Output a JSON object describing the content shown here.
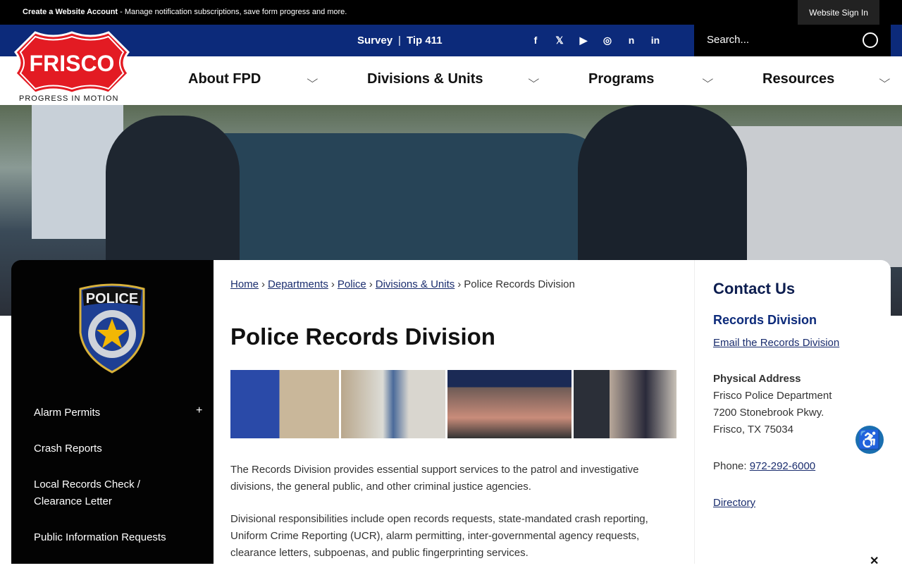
{
  "topbar": {
    "create_label": "Create a Website Account",
    "create_desc": " - Manage notification subscriptions, save form progress and more.",
    "signin": "Website Sign In"
  },
  "utility": {
    "links": [
      "Survey",
      "Tip 411"
    ],
    "separator": "|",
    "social": [
      {
        "icon": "facebook-icon",
        "glyph": "f"
      },
      {
        "icon": "x-icon",
        "glyph": "𝕏"
      },
      {
        "icon": "youtube-icon",
        "glyph": "▶"
      },
      {
        "icon": "instagram-icon",
        "glyph": "◎"
      },
      {
        "icon": "nextdoor-icon",
        "glyph": "n"
      },
      {
        "icon": "linkedin-icon",
        "glyph": "in"
      }
    ],
    "search_placeholder": "Search..."
  },
  "logo": {
    "text": "FRISCO",
    "tagline": "PROGRESS IN MOTION"
  },
  "nav": [
    "About FPD",
    "Divisions & Units",
    "Programs",
    "Resources"
  ],
  "sidebar": {
    "badge_text": "POLICE",
    "items": [
      "Alarm Permits",
      "Crash Reports",
      "Local Records Check / Clearance Letter",
      "Public Information Requests"
    ]
  },
  "breadcrumb": {
    "links": [
      "Home",
      "Departments",
      "Police",
      "Divisions & Units"
    ],
    "current": "Police Records Division"
  },
  "main": {
    "title": "Police Records Division",
    "paragraphs": [
      "The Records Division provides essential support services to the patrol and investigative divisions, the general public, and other criminal justice agencies.",
      "Divisional responsibilities include open records requests, state-mandated crash reporting, Uniform Crime Reporting (UCR), alarm permitting, inter-governmental agency requests, clearance letters, subpoenas, and public fingerprinting services."
    ]
  },
  "contact": {
    "title": "Contact Us",
    "division": "Records Division",
    "email_link": "Email the Records Division",
    "address_label": "Physical Address",
    "address": [
      "Frisco Police Department",
      "7200 Stonebrook Pkwy.",
      "Frisco, TX 75034"
    ],
    "phone_label": "Phone: ",
    "phone": "972-292-6000",
    "directory": "Directory"
  },
  "colors": {
    "brand_blue": "#0c2a7a",
    "frisco_red": "#e31b23",
    "link": "#1a2d6e"
  }
}
